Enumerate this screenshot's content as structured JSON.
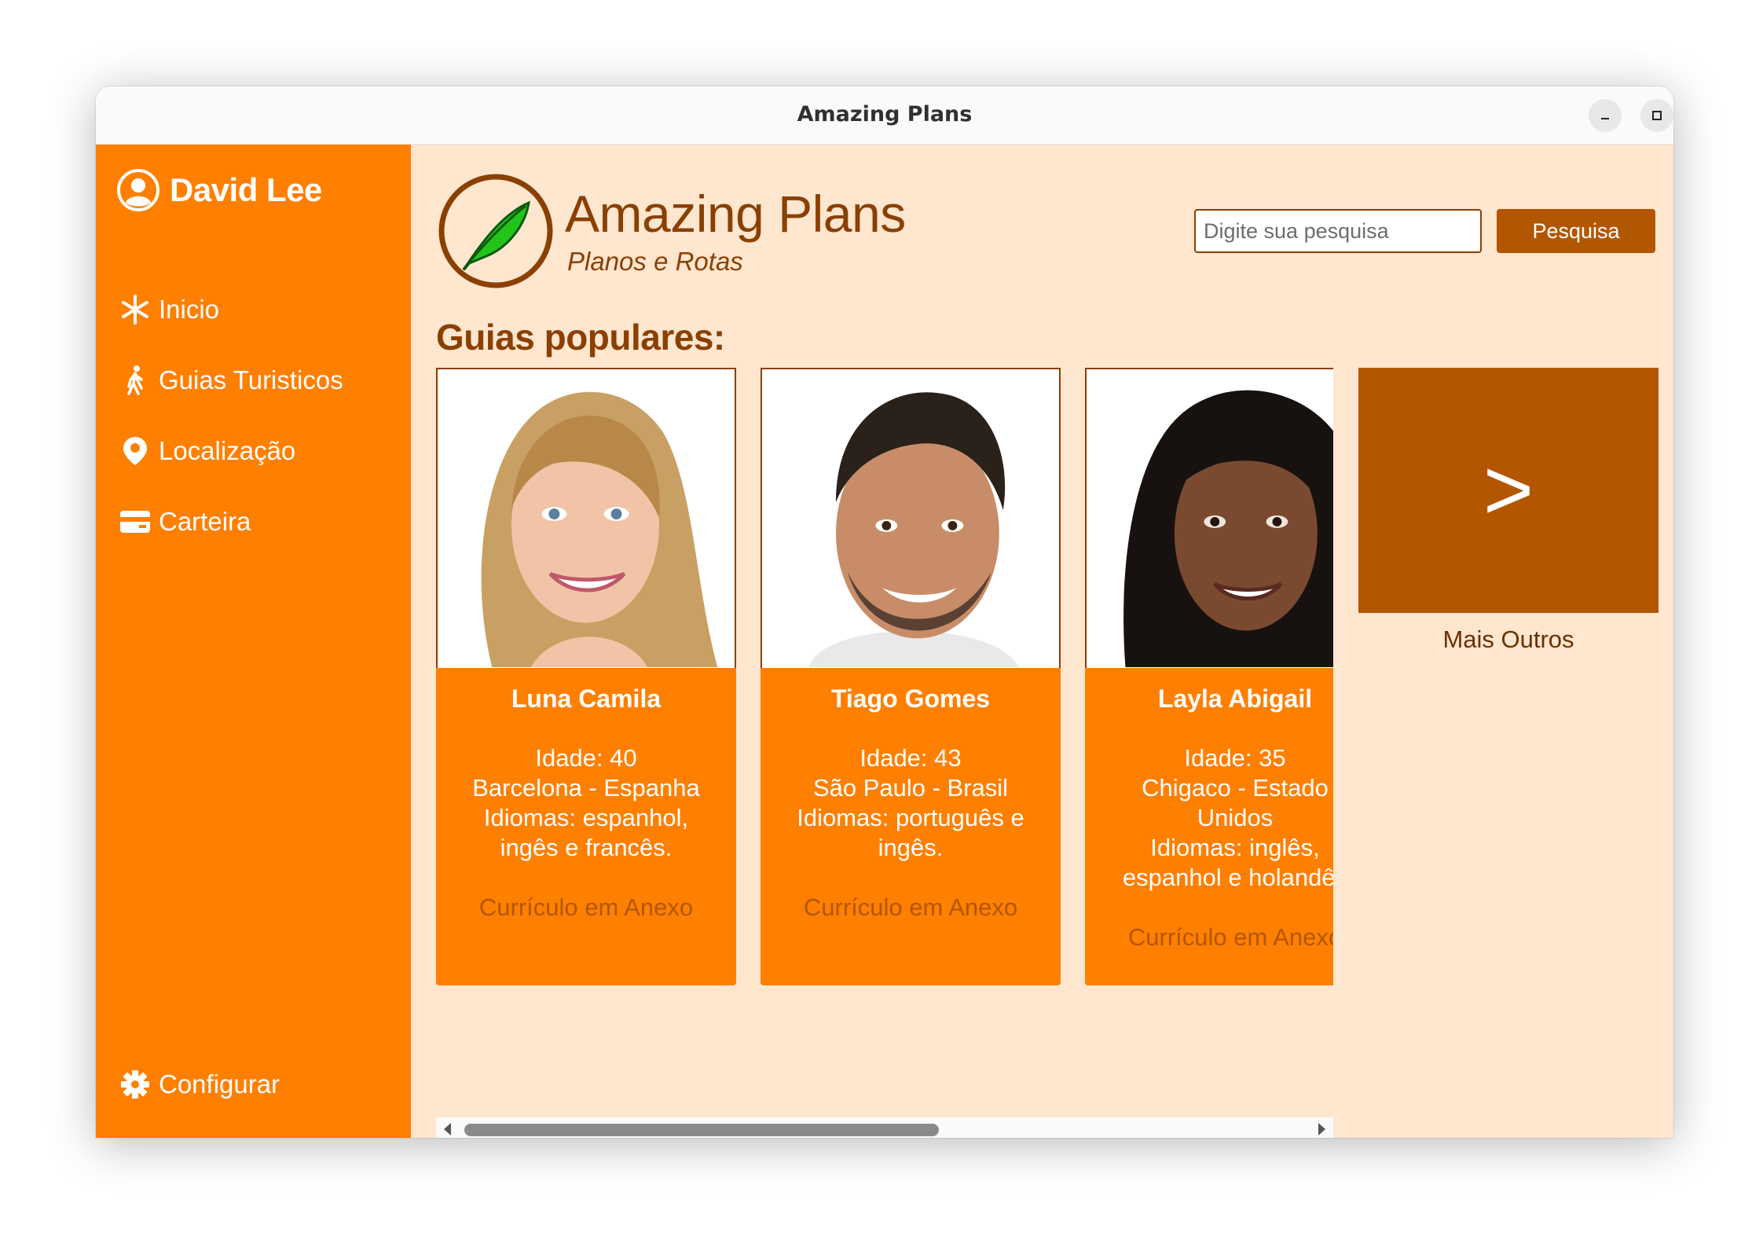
{
  "window": {
    "title": "Amazing Plans"
  },
  "sidebar": {
    "user_name": "David Lee",
    "items": [
      {
        "label": "Inicio",
        "icon": "asterisk-icon"
      },
      {
        "label": "Guias Turisticos",
        "icon": "walking-person-icon"
      },
      {
        "label": "Localização",
        "icon": "location-pin-icon"
      },
      {
        "label": "Carteira",
        "icon": "wallet-card-icon"
      }
    ],
    "settings_label": "Configurar"
  },
  "header": {
    "title": "Amazing Plans",
    "subtitle": "Planos e Rotas",
    "search_placeholder": "Digite sua pesquisa",
    "search_button": "Pesquisa"
  },
  "guides": {
    "section_title": "Guias populares:",
    "cards": [
      {
        "name": "Luna Camila",
        "lines": [
          "Idade: 40",
          "Barcelona - Espanha",
          "Idiomas: espanhol,",
          "ingês e francês."
        ],
        "cv": "Currículo em Anexo"
      },
      {
        "name": "Tiago Gomes",
        "lines": [
          "Idade: 43",
          "São Paulo - Brasil",
          "Idiomas: português e",
          "ingês."
        ],
        "cv": "Currículo em Anexo"
      },
      {
        "name": "Layla Abigail",
        "lines": [
          "Idade: 35",
          "Chigaco - Estado",
          "Unidos",
          "Idiomas: inglês,",
          "espanhol e holandês"
        ],
        "cv": "Currículo em Anexo"
      }
    ],
    "more_symbol": ">",
    "more_label": "Mais Outros"
  },
  "colors": {
    "sidebar": "#ff7f00",
    "main_bg": "#ffe6cf",
    "brand_text": "#8a4000",
    "button": "#b35600"
  }
}
